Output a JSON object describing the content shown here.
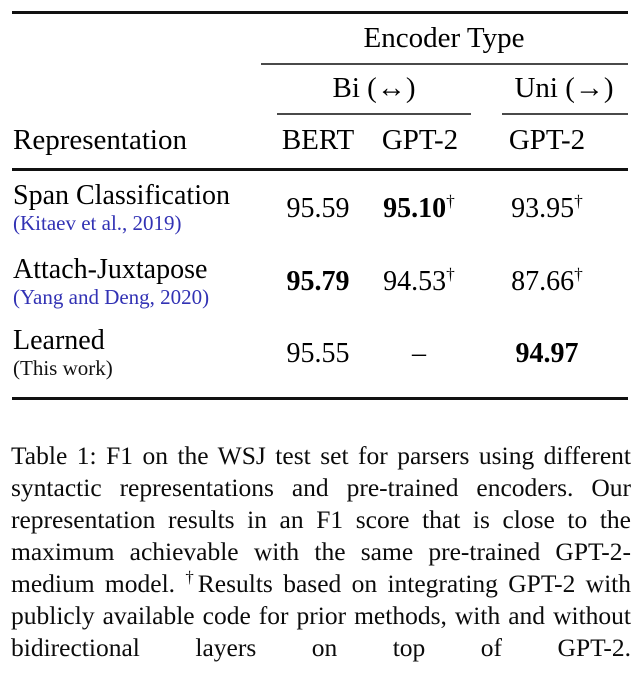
{
  "table": {
    "group_header": "Encoder Type",
    "subgroups": [
      {
        "label": "Bi (↔)"
      },
      {
        "label": "Uni (→)"
      }
    ],
    "columns": [
      {
        "label": "Representation"
      },
      {
        "label": "BERT"
      },
      {
        "label": "GPT-2"
      },
      {
        "label": "GPT-2"
      }
    ],
    "rows": [
      {
        "name": "Span Classification",
        "citation": "(Kitaev et al., 2019)",
        "citation_is_link": true,
        "bert": "95.59",
        "bert_bold": false,
        "bert_dagger": "",
        "gpt2_bi": "95.10",
        "gpt2_bi_bold": true,
        "gpt2_bi_dagger": "†",
        "gpt2_uni": "93.95",
        "gpt2_uni_bold": false,
        "gpt2_uni_dagger": "†"
      },
      {
        "name": "Attach-Juxtapose",
        "citation": "(Yang and Deng, 2020)",
        "citation_is_link": true,
        "bert": "95.79",
        "bert_bold": true,
        "bert_dagger": "",
        "gpt2_bi": "94.53",
        "gpt2_bi_bold": false,
        "gpt2_bi_dagger": "†",
        "gpt2_uni": "87.66",
        "gpt2_uni_bold": false,
        "gpt2_uni_dagger": "†"
      },
      {
        "name": "Learned",
        "citation": "(This work)",
        "citation_is_link": false,
        "bert": "95.55",
        "bert_bold": false,
        "bert_dagger": "",
        "gpt2_bi": "–",
        "gpt2_bi_bold": false,
        "gpt2_bi_dagger": "",
        "gpt2_uni": "94.97",
        "gpt2_uni_bold": true,
        "gpt2_uni_dagger": ""
      }
    ]
  },
  "caption": {
    "part1": "Table 1:  F1 on the WSJ test set for parsers using different syntactic representations and pre-trained encoders. Our representation results in an F1 score that is close to the maximum achievable with the same pre-trained GPT-2-medium model.  ",
    "dagger": "†",
    "part2": "Results based on integrating GPT-2 with publicly available code for prior methods, with and without bidirectional layers on top of GPT-2."
  },
  "colors": {
    "citation_link": "#3232b4",
    "text": "#000000",
    "rule": "#111111"
  }
}
